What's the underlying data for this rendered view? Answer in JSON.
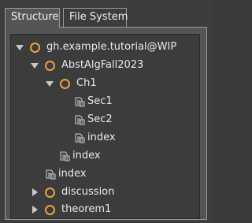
{
  "tabs": [
    {
      "label": "Structure",
      "active": true
    },
    {
      "label": "File System",
      "active": false
    }
  ],
  "tree": [
    {
      "label": "gh.example.tutorial@WIP",
      "kind": "folder",
      "expanded": true,
      "depth": 0
    },
    {
      "label": "AbstAlgFall2023",
      "kind": "folder",
      "expanded": true,
      "depth": 1
    },
    {
      "label": "Ch1",
      "kind": "folder",
      "expanded": true,
      "depth": 2
    },
    {
      "label": "Sec1",
      "kind": "document",
      "depth": 3
    },
    {
      "label": "Sec2",
      "kind": "document",
      "depth": 3
    },
    {
      "label": "index",
      "kind": "document",
      "depth": 3
    },
    {
      "label": "index",
      "kind": "document",
      "depth": 2
    },
    {
      "label": "index",
      "kind": "document",
      "depth": 1
    },
    {
      "label": "discussion",
      "kind": "folder",
      "expanded": false,
      "depth": 1
    },
    {
      "label": "theorem1",
      "kind": "folder",
      "expanded": false,
      "depth": 1
    }
  ],
  "colors": {
    "folder_icon": "#e8a33d",
    "background": "#3c3c3c",
    "text": "#e8e8e8"
  },
  "icons": {
    "folder": "circle-folder-icon",
    "document": "document-icon",
    "expanded": "triangle-down-icon",
    "collapsed": "triangle-right-icon"
  }
}
